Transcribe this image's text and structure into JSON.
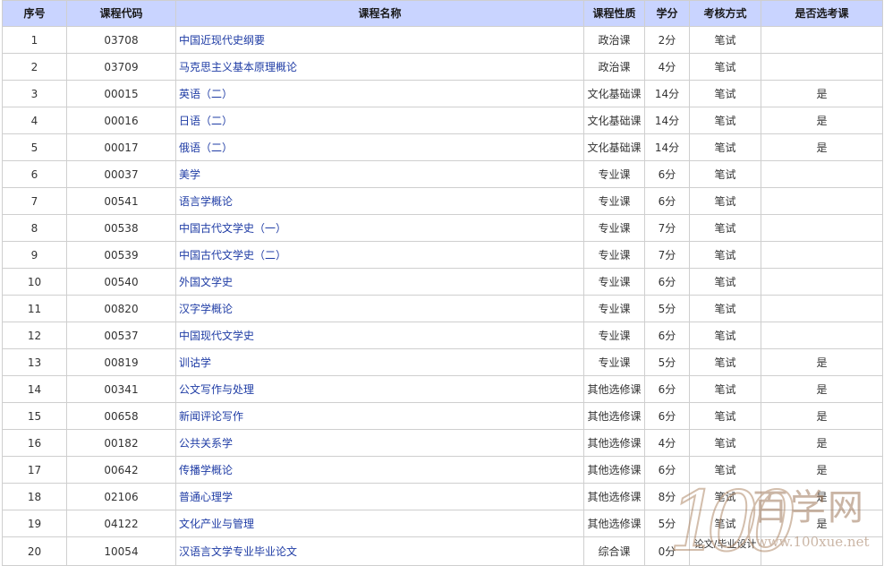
{
  "table": {
    "headers": [
      "序号",
      "课程代码",
      "课程名称",
      "课程性质",
      "学分",
      "考核方式",
      "是否选考课"
    ],
    "rows": [
      {
        "no": "1",
        "code": "03708",
        "name": "中国近现代史纲要",
        "type": "政治课",
        "credit": "2分",
        "exam": "笔试",
        "elective": ""
      },
      {
        "no": "2",
        "code": "03709",
        "name": "马克思主义基本原理概论",
        "type": "政治课",
        "credit": "4分",
        "exam": "笔试",
        "elective": ""
      },
      {
        "no": "3",
        "code": "00015",
        "name": "英语（二）",
        "type": "文化基础课",
        "credit": "14分",
        "exam": "笔试",
        "elective": "是"
      },
      {
        "no": "4",
        "code": "00016",
        "name": "日语（二）",
        "type": "文化基础课",
        "credit": "14分",
        "exam": "笔试",
        "elective": "是"
      },
      {
        "no": "5",
        "code": "00017",
        "name": "俄语（二）",
        "type": "文化基础课",
        "credit": "14分",
        "exam": "笔试",
        "elective": "是"
      },
      {
        "no": "6",
        "code": "00037",
        "name": "美学",
        "type": "专业课",
        "credit": "6分",
        "exam": "笔试",
        "elective": ""
      },
      {
        "no": "7",
        "code": "00541",
        "name": "语言学概论",
        "type": "专业课",
        "credit": "6分",
        "exam": "笔试",
        "elective": ""
      },
      {
        "no": "8",
        "code": "00538",
        "name": "中国古代文学史（一）",
        "type": "专业课",
        "credit": "7分",
        "exam": "笔试",
        "elective": ""
      },
      {
        "no": "9",
        "code": "00539",
        "name": "中国古代文学史（二）",
        "type": "专业课",
        "credit": "7分",
        "exam": "笔试",
        "elective": ""
      },
      {
        "no": "10",
        "code": "00540",
        "name": "外国文学史",
        "type": "专业课",
        "credit": "6分",
        "exam": "笔试",
        "elective": ""
      },
      {
        "no": "11",
        "code": "00820",
        "name": "汉字学概论",
        "type": "专业课",
        "credit": "5分",
        "exam": "笔试",
        "elective": ""
      },
      {
        "no": "12",
        "code": "00537",
        "name": "中国现代文学史",
        "type": "专业课",
        "credit": "6分",
        "exam": "笔试",
        "elective": ""
      },
      {
        "no": "13",
        "code": "00819",
        "name": "训诂学",
        "type": "专业课",
        "credit": "5分",
        "exam": "笔试",
        "elective": "是"
      },
      {
        "no": "14",
        "code": "00341",
        "name": "公文写作与处理",
        "type": "其他选修课",
        "credit": "6分",
        "exam": "笔试",
        "elective": "是"
      },
      {
        "no": "15",
        "code": "00658",
        "name": "新闻评论写作",
        "type": "其他选修课",
        "credit": "6分",
        "exam": "笔试",
        "elective": "是"
      },
      {
        "no": "16",
        "code": "00182",
        "name": "公共关系学",
        "type": "其他选修课",
        "credit": "4分",
        "exam": "笔试",
        "elective": "是"
      },
      {
        "no": "17",
        "code": "00642",
        "name": "传播学概论",
        "type": "其他选修课",
        "credit": "6分",
        "exam": "笔试",
        "elective": "是"
      },
      {
        "no": "18",
        "code": "02106",
        "name": "普通心理学",
        "type": "其他选修课",
        "credit": "8分",
        "exam": "笔试",
        "elective": "是"
      },
      {
        "no": "19",
        "code": "04122",
        "name": "文化产业与管理",
        "type": "其他选修课",
        "credit": "5分",
        "exam": "笔试",
        "elective": "是"
      },
      {
        "no": "20",
        "code": "10054",
        "name": "汉语言文学专业毕业论文",
        "type": "综合课",
        "credit": "0分",
        "exam": "论文/毕业设计",
        "elective": ""
      }
    ]
  },
  "watermark": {
    "number": "100",
    "brand_cn": "百学网",
    "url": "www.100xue.net"
  },
  "colors": {
    "header_bg": "#c9d4ff",
    "link": "#1f3ca5",
    "border": "#cfcfcf",
    "watermark": "#b08a6a"
  }
}
